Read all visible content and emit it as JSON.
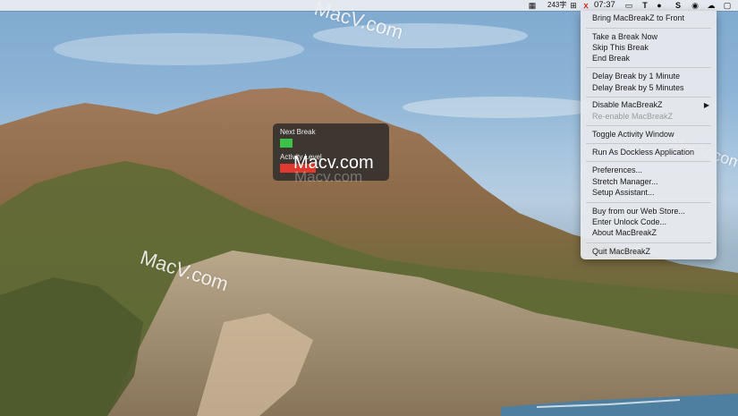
{
  "menubar": {
    "word_count": "243字",
    "clock": "07:37",
    "icons": [
      "grid-icon",
      "input-method-icon",
      "macbreakz-icon",
      "video-icon",
      "text-icon",
      "wechat-icon",
      "s-icon",
      "eye-icon",
      "cloud-icon",
      "chat-icon",
      "search-icon"
    ]
  },
  "activity_window": {
    "next_break_label": "Next Break",
    "activity_level_label": "Activity Level",
    "next_break_color": "#3fc24a",
    "activity_level_color": "#e0392f"
  },
  "menu": {
    "items": [
      {
        "label": "Bring MacBreakZ to Front",
        "enabled": true
      },
      {
        "label": "Take a Break Now",
        "enabled": true
      },
      {
        "label": "Skip This Break",
        "enabled": true
      },
      {
        "label": "End Break",
        "enabled": true
      },
      {
        "label": "Delay Break by 1 Minute",
        "enabled": true
      },
      {
        "label": "Delay Break by 5 Minutes",
        "enabled": true
      },
      {
        "label": "Disable MacBreakZ",
        "enabled": true,
        "submenu": "▶"
      },
      {
        "label": "Re-enable MacBreakZ",
        "enabled": false
      },
      {
        "label": "Toggle Activity Window",
        "enabled": true
      },
      {
        "label": "Run As Dockless Application",
        "enabled": true
      },
      {
        "label": "Preferences...",
        "enabled": true
      },
      {
        "label": "Stretch Manager...",
        "enabled": true
      },
      {
        "label": "Setup Assistant...",
        "enabled": true
      },
      {
        "label": "Buy from our Web Store...",
        "enabled": true
      },
      {
        "label": "Enter Unlock Code...",
        "enabled": true
      },
      {
        "label": "About MacBreakZ",
        "enabled": true
      },
      {
        "label": "Quit MacBreakZ",
        "enabled": true
      }
    ]
  },
  "watermarks": {
    "top": "MacV.com",
    "center": "Macv.com",
    "center_faint": "Macv.com",
    "left": "MacV.com",
    "right": "MacV.com"
  }
}
